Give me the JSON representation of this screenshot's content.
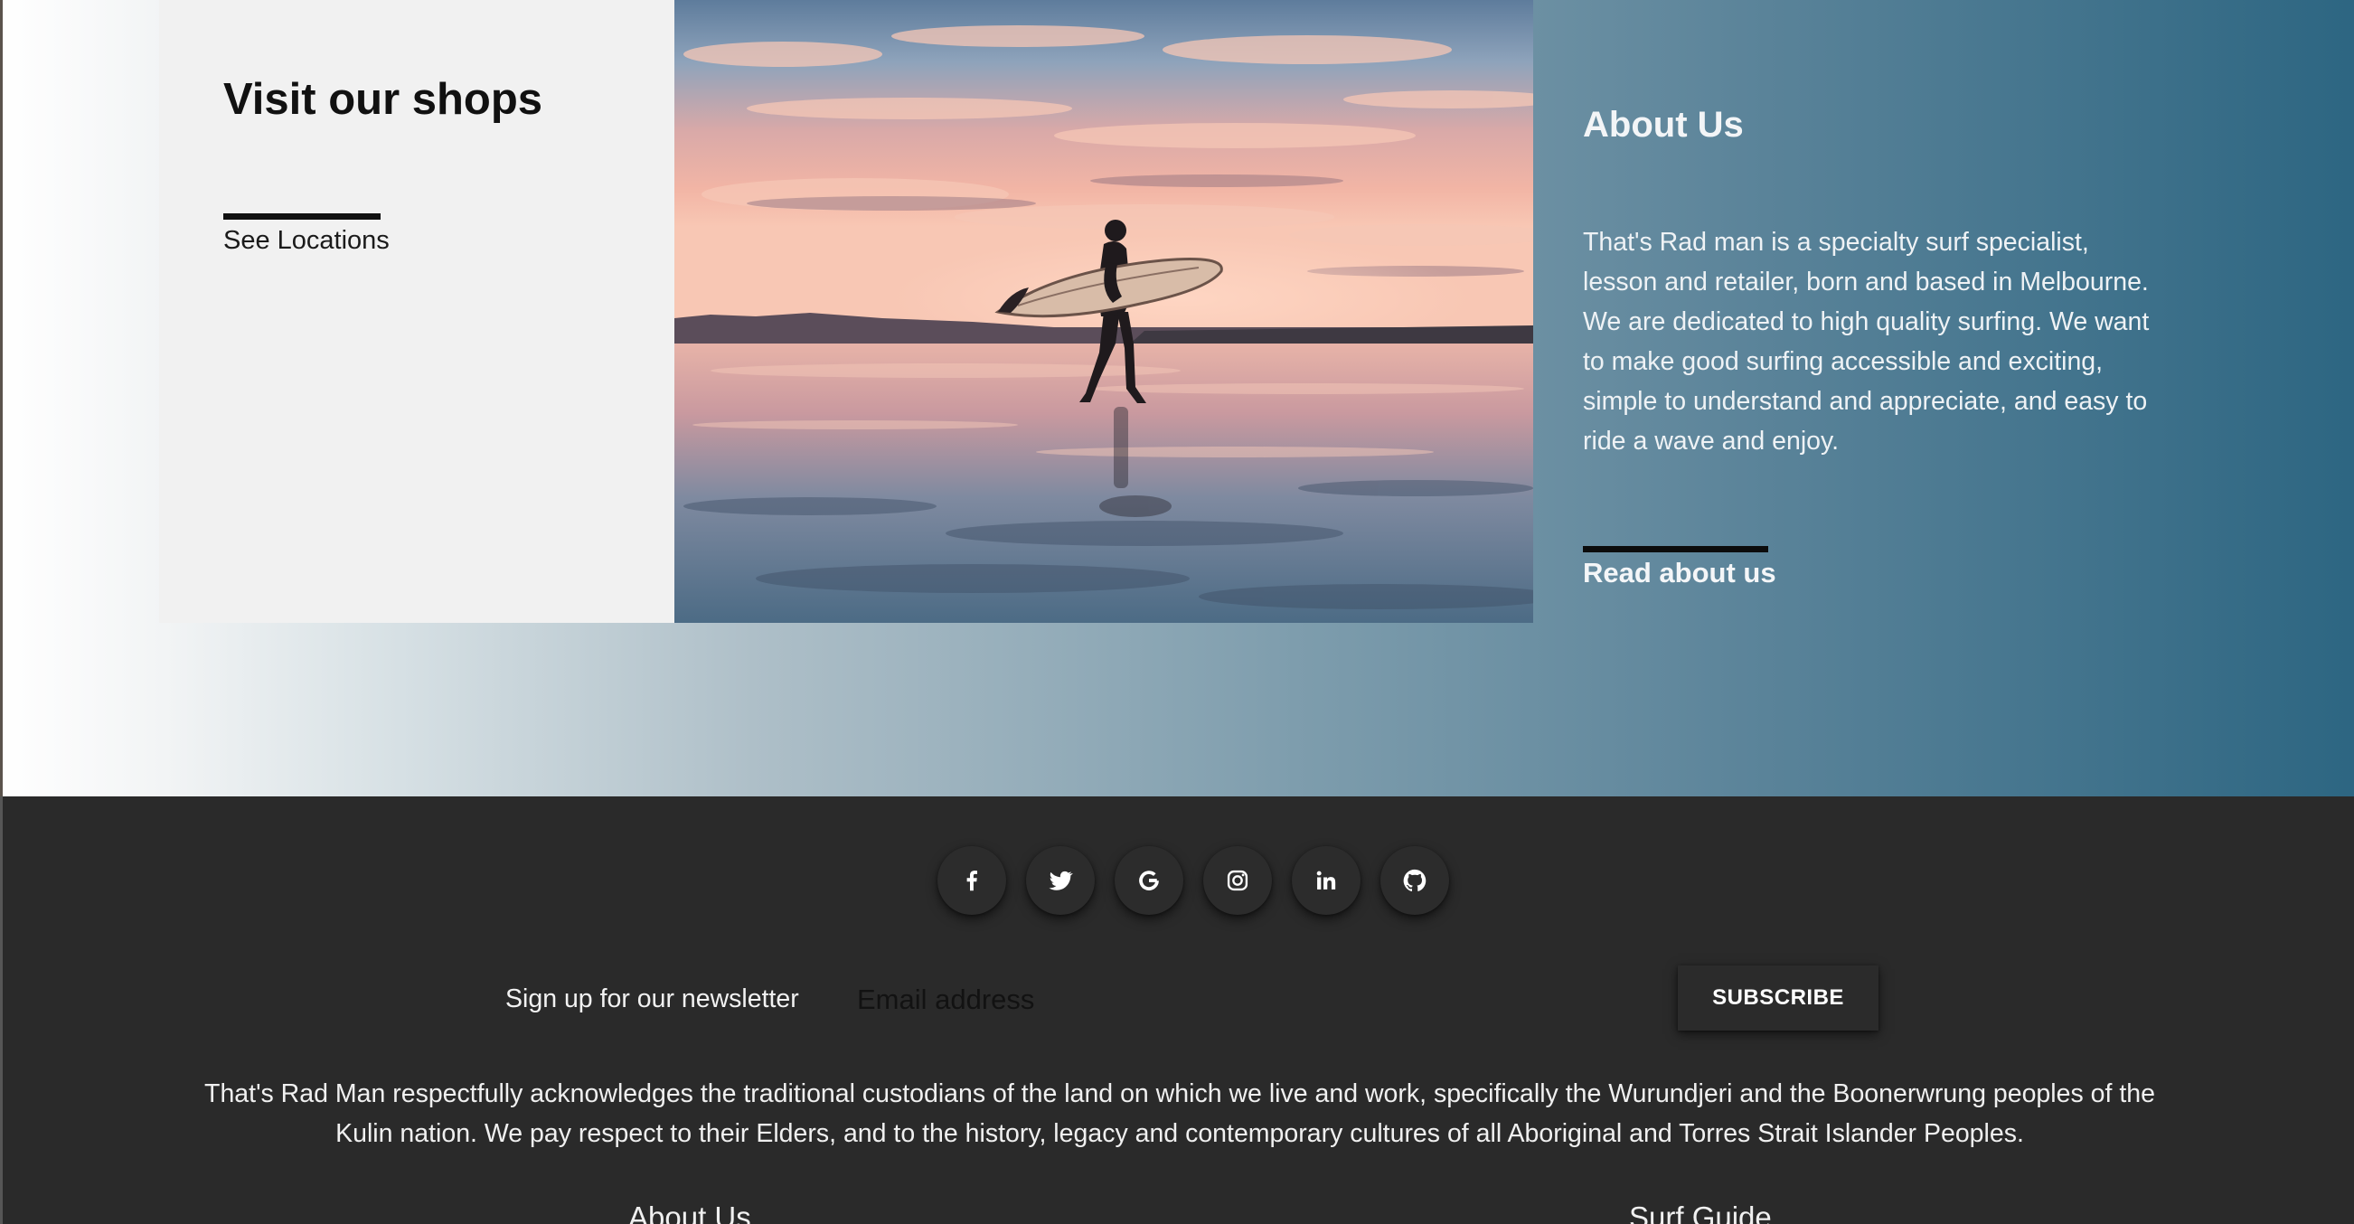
{
  "shops": {
    "title": "Visit our shops",
    "link_label": "See Locations"
  },
  "hero_image": {
    "alt": "Surfer walking on beach at sunset"
  },
  "about": {
    "title": "About Us",
    "description": "That's Rad man is a specialty surf specialist, lesson and retailer, born and based in Melbourne. We are dedicated to high quality surfing. We want to make good surfing accessible and exciting, simple to understand and appreciate, and easy to ride a wave and enjoy.",
    "link_label": "Read about us"
  },
  "footer": {
    "socials": [
      {
        "name": "facebook",
        "icon": "facebook-icon"
      },
      {
        "name": "twitter",
        "icon": "twitter-icon"
      },
      {
        "name": "google",
        "icon": "google-icon"
      },
      {
        "name": "instagram",
        "icon": "instagram-icon"
      },
      {
        "name": "linkedin",
        "icon": "linkedin-icon"
      },
      {
        "name": "github",
        "icon": "github-icon"
      }
    ],
    "newsletter": {
      "label": "Sign up for our newsletter",
      "placeholder": "Email address",
      "button_label": "SUBSCRIBE"
    },
    "acknowledgement": "That's Rad Man respectfully acknowledges the traditional custodians of the land on which we live and work, specifically the Wurundjeri and the Boonerwrung peoples of the Kulin nation. We pay respect to their Elders, and to the history, legacy and contemporary cultures of all Aboriginal and Torres Strait Islander Peoples.",
    "columns": [
      "About Us",
      "Surf Guide"
    ]
  },
  "colors": {
    "footer_bg": "#2a2a2a",
    "card_bg": "#f1f1f1",
    "gradient_end": "#2d6682"
  }
}
